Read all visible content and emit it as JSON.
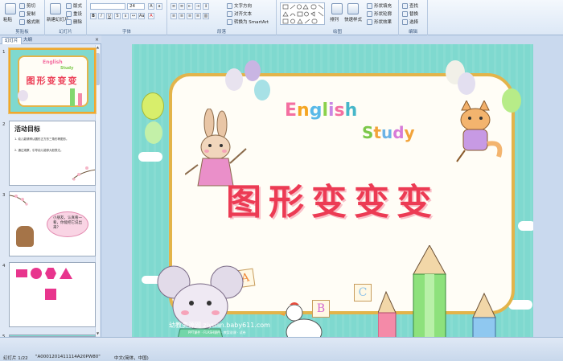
{
  "ribbon": {
    "clipboard": {
      "paste": "粘贴",
      "cut": "剪切",
      "copy": "复制",
      "format_painter": "格式刷",
      "group": "剪贴板"
    },
    "slides": {
      "new_slide": "新建幻灯片",
      "layout": "版式",
      "reset": "重设",
      "delete": "删除",
      "group": "幻灯片"
    },
    "font": {
      "size": "24",
      "group": "字体"
    },
    "paragraph": {
      "text_direction": "文字方向",
      "align_text": "对齐文本",
      "convert_smartart": "转换为 SmartArt",
      "group": "段落"
    },
    "drawing": {
      "arrange": "排列",
      "quick_styles": "快速样式",
      "shape_fill": "形状填充",
      "shape_outline": "形状轮廓",
      "shape_effects": "形状效果",
      "group": "绘图"
    },
    "editing": {
      "find": "查找",
      "replace": "替换",
      "select": "选择",
      "group": "编辑"
    }
  },
  "left_pane": {
    "tabs": [
      {
        "label": "幻灯片"
      },
      {
        "label": "大纲"
      }
    ],
    "close": "×",
    "thumbnails": [
      {
        "num": "1",
        "title": "图形变变变",
        "english": "English",
        "study": "Study"
      },
      {
        "num": "2",
        "heading": "活动目标",
        "line1": "1.  幼儿能够辨认圆形正方形三角形等图形。",
        "line2": "2.  通过观察，引导幼儿能够大胆表达。"
      },
      {
        "num": "3",
        "speech": "小朋友，认真看一看，你能把它说出来？"
      },
      {
        "num": "4"
      },
      {
        "num": "5"
      }
    ]
  },
  "slide": {
    "title": "图形变变变",
    "english": [
      "E",
      "n",
      "g",
      "l",
      "i",
      "s",
      "h"
    ],
    "english_colors": [
      "#f46fa1",
      "#f5a623",
      "#58b9e8",
      "#8bd14b",
      "#c987e5",
      "#f46fa1",
      "#47b7c9"
    ],
    "study": [
      "S",
      "t",
      "u",
      "d",
      "y"
    ],
    "study_colors": [
      "#7cc84a",
      "#f2a33a",
      "#6bb3e6",
      "#d77bd8",
      "#f2a33a"
    ],
    "blocks": [
      "A",
      "B",
      "C"
    ],
    "watermark_main": "幼教资源网 ziyuan.baby611.com",
    "watermark_sub": "PPT课件 · FLASH课件 · 教案说课 · 试卷"
  },
  "status": {
    "slide_info": "幻灯片 1/22",
    "theme": "\"A0001201411114A20PW80\"",
    "language": "中文(简体，中国)"
  },
  "colors": {
    "ribbon_bg": "#dce8f6",
    "slide_bg": "#7fd9cf",
    "frame_border": "#e3b44a",
    "title_red": "#ec3b54",
    "selected_border": "#f2a72b"
  }
}
